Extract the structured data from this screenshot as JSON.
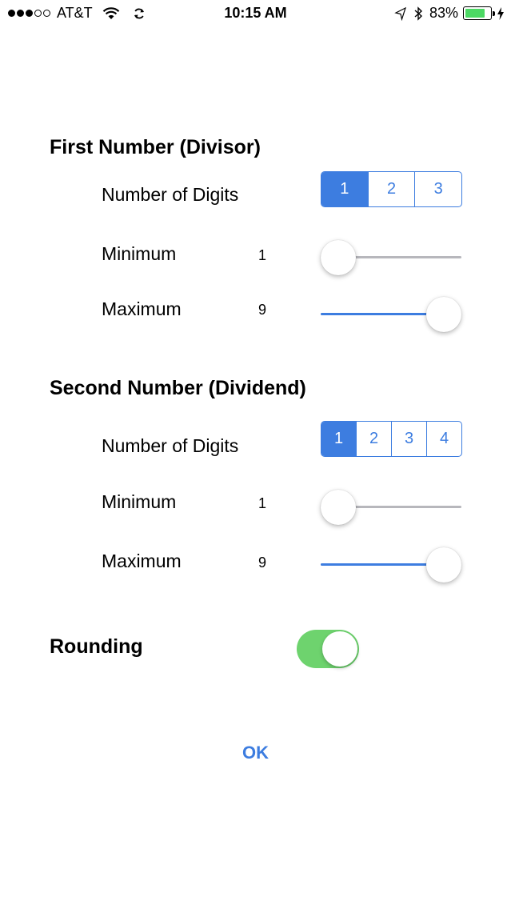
{
  "status_bar": {
    "carrier": "AT&T",
    "time": "10:15 AM",
    "battery_percent": "83%",
    "battery_level": 0.83,
    "signal_bars_filled": 3,
    "signal_bars_total": 5,
    "icons": [
      "wifi-icon",
      "sync-icon",
      "location-arrow-icon",
      "bluetooth-icon",
      "battery-icon",
      "charging-bolt-icon"
    ]
  },
  "first_number": {
    "title": "First Number (Divisor)",
    "digits_label": "Number of Digits",
    "digits_options": [
      "1",
      "2",
      "3"
    ],
    "digits_selected": "1",
    "minimum_label": "Minimum",
    "minimum_value": "1",
    "minimum_slider_fraction": 0,
    "maximum_label": "Maximum",
    "maximum_value": "9",
    "maximum_slider_fraction": 1
  },
  "second_number": {
    "title": "Second Number (Dividend)",
    "digits_label": "Number of Digits",
    "digits_options": [
      "1",
      "2",
      "3",
      "4"
    ],
    "digits_selected": "1",
    "minimum_label": "Minimum",
    "minimum_value": "1",
    "minimum_slider_fraction": 0,
    "maximum_label": "Maximum",
    "maximum_value": "9",
    "maximum_slider_fraction": 1
  },
  "rounding": {
    "label": "Rounding",
    "enabled": true
  },
  "ok_label": "OK",
  "colors": {
    "accent": "#3d7de0",
    "toggle_on": "#6ed36e",
    "track_off": "#b7b7bc",
    "battery": "#4cd964"
  }
}
